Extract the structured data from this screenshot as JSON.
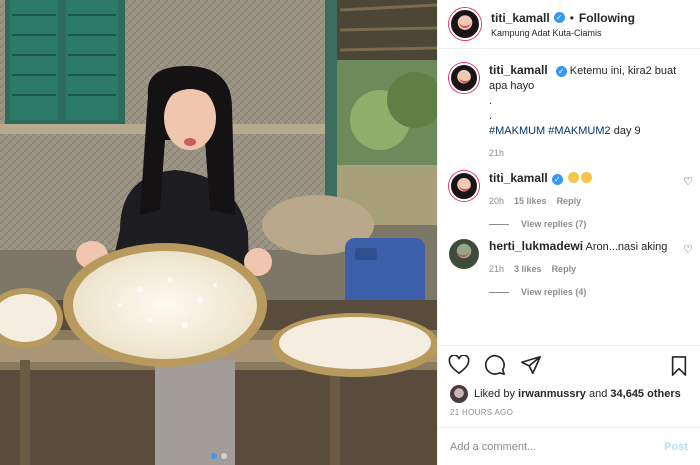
{
  "author": {
    "username": "titi_kamall",
    "follow_status": "Following",
    "location": "Kampung Adat Kuta-Ciamis"
  },
  "caption": {
    "username": "titi_kamall",
    "text": "Ketemu ini, kira2 buat apa hayo",
    "dots": [
      ".",
      "."
    ],
    "hashtags": [
      "#MAKMUM",
      "#MAKMUM2"
    ],
    "suffix": "day 9",
    "time": "21h"
  },
  "comments": [
    {
      "username": "titi_kamall",
      "verified": true,
      "text": "",
      "emojis": [
        "rolling-laugh-emoji",
        "rolling-laugh-emoji"
      ],
      "time": "20h",
      "likes": "15 likes",
      "reply_label": "Reply",
      "view_replies": "View replies (7)"
    },
    {
      "username": "herti_lukmadewi",
      "verified": false,
      "text": "Aron...nasi aking",
      "time": "21h",
      "likes": "3 likes",
      "reply_label": "Reply",
      "view_replies": "View replies (4)"
    }
  ],
  "likes": {
    "prefix": "Liked by",
    "user": "irwanmussry",
    "joiner": "and",
    "others": "34,645 others"
  },
  "posted_ago": "21 HOURS AGO",
  "add_comment": {
    "placeholder": "Add a comment...",
    "post_label": "Post"
  },
  "carousel": {
    "total": 2,
    "active_index": 0
  },
  "colors": {
    "link": "#00376b",
    "verified": "#3897f0",
    "muted": "#8e8e8e",
    "post_disabled": "#b2dffc",
    "carousel_active": "#3b9bf1"
  }
}
